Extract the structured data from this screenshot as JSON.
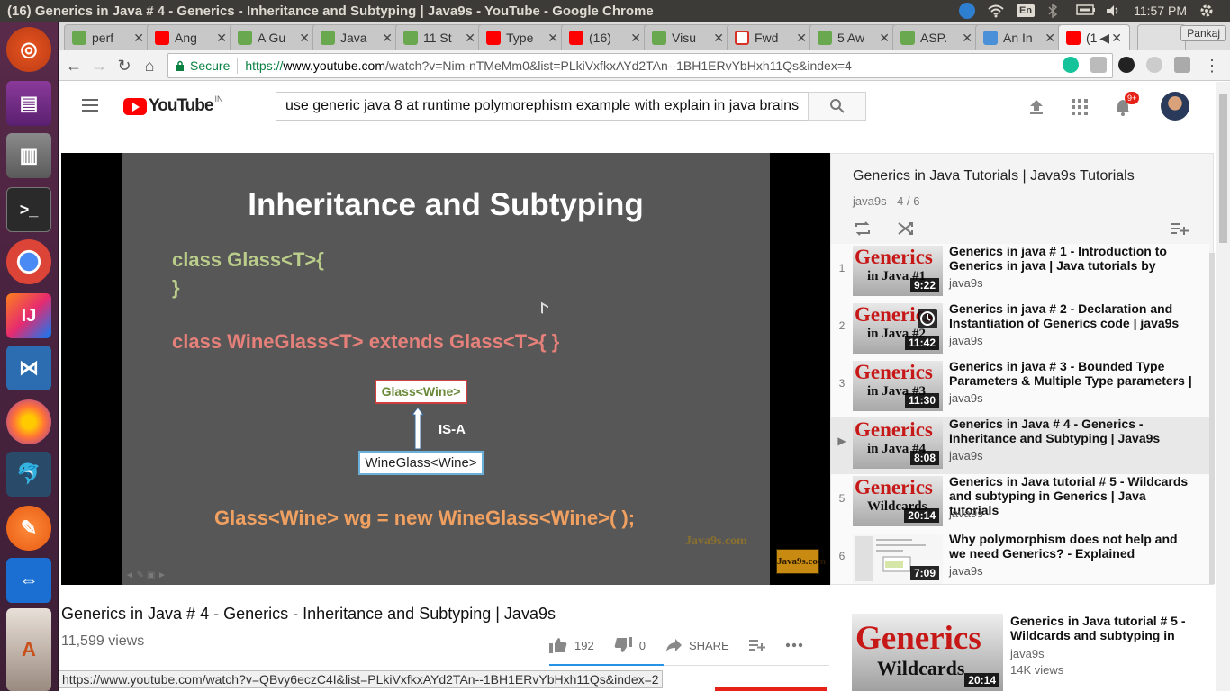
{
  "os": {
    "window_title": "(16) Generics in Java # 4 - Generics - Inheritance and Subtyping | Java9s - YouTube - Google Chrome",
    "keyboard": "En",
    "clock": "11:57 PM"
  },
  "launcher": {
    "items": [
      "Ubuntu",
      "Files",
      "Files Manager",
      "Terminal",
      "Chrome",
      "IntelliJ",
      "VS Code",
      "Firefox",
      "MySQL Workbench",
      "Postman",
      "TeamViewer",
      "Store"
    ]
  },
  "browser": {
    "tabs": [
      {
        "label": "perf"
      },
      {
        "label": "Ang"
      },
      {
        "label": "A Gu"
      },
      {
        "label": "Java"
      },
      {
        "label": "11 St"
      },
      {
        "label": "Type"
      },
      {
        "label": "(16)"
      },
      {
        "label": "Visu"
      },
      {
        "label": "Fwd"
      },
      {
        "label": "5 Aw"
      },
      {
        "label": "ASP."
      },
      {
        "label": "An In"
      },
      {
        "label": "(1"
      }
    ],
    "profile": "Pankaj",
    "secure_label": "Secure",
    "url_proto": "https://",
    "url_host": "www.youtube.com",
    "url_rest": "/watch?v=Nim-nTMeMm0&list=PLkiVxfkxAYd2TAn--1BH1ERvYbHxh11Qs&index=4"
  },
  "youtube": {
    "logo_text": "YouTube",
    "country": "IN",
    "search_query": "use generic java 8 at runtime polymorephism example with explain in java brains",
    "notif_count": "9+"
  },
  "slide": {
    "title": "Inheritance and Subtyping",
    "code_line1": "class Glass<T>{",
    "code_line2": "}",
    "code_line3": "class WineGlass<T> extends Glass<T>{ }",
    "box_parent": "Glass<Wine>",
    "relation": "IS-A",
    "box_child": "WineGlass<Wine>",
    "code_line4": "Glass<Wine> wg = new WineGlass<Wine>( );",
    "watermark": "Java9s.com",
    "logo": "Java9s.com"
  },
  "video": {
    "title": "Generics in Java # 4 - Generics - Inheritance and Subtyping | Java9s",
    "views": "11,599 views",
    "likes": "192",
    "dislikes": "0",
    "share": "SHARE"
  },
  "playlist": {
    "title": "Generics in Java Tutorials | Java9s Tutorials",
    "subtitle": "java9s - 4 / 6",
    "items": [
      {
        "index": "1",
        "title": "Generics in java # 1 - Introduction to Generics in java | Java tutorials by",
        "channel": "java9s",
        "duration": "9:22",
        "thumb_top": "Generics",
        "thumb_bottom": "in Java #1"
      },
      {
        "index": "2",
        "title": "Generics in java # 2 - Declaration and Instantiation of Generics code | java9s",
        "channel": "java9s",
        "duration": "11:42",
        "thumb_top": "Generics",
        "thumb_bottom": "in Java #2"
      },
      {
        "index": "3",
        "title": "Generics in java # 3 - Bounded Type Parameters & Multiple Type parameters |",
        "channel": "java9s",
        "duration": "11:30",
        "thumb_top": "Generics",
        "thumb_bottom": "in Java #3"
      },
      {
        "index": "▶",
        "title": "Generics in Java # 4 - Generics - Inheritance and Subtyping | Java9s",
        "channel": "java9s",
        "duration": "8:08",
        "thumb_top": "Generics",
        "thumb_bottom": "in Java #4"
      },
      {
        "index": "5",
        "title": "Generics in Java tutorial # 5 - Wildcards and subtyping in Generics | Java tutorials",
        "channel": "java9s",
        "duration": "20:14",
        "thumb_top": "Generics",
        "thumb_bottom": "Wildcards"
      },
      {
        "index": "6",
        "title": "Why polymorphism does not help and we need Generics? - Explained",
        "channel": "java9s",
        "duration": "7:09",
        "thumb_top": "",
        "thumb_bottom": ""
      }
    ]
  },
  "up_next": {
    "title": "Generics in Java tutorial # 5 - Wildcards and subtyping in",
    "channel": "java9s",
    "views": "14K views",
    "duration": "20:14",
    "thumb_top": "Generics",
    "thumb_bottom": "Wildcards"
  },
  "status_bar": {
    "url": "https://www.youtube.com/watch?v=QBvy6eczC4I&list=PLkiVxfkxAYd2TAn--1BH1ERvYbHxh11Qs&index=2"
  }
}
